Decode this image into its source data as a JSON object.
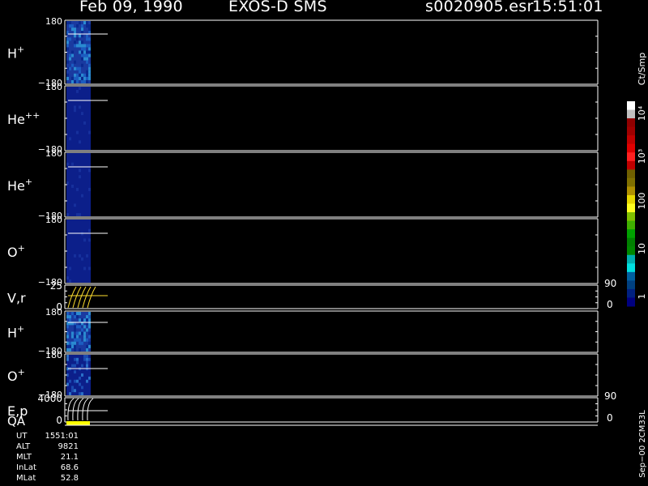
{
  "header": {
    "date": "Feb 09, 1990",
    "instrument": "EXOS-D SMS",
    "file": "s0020905.esr",
    "time": "15:51:01"
  },
  "colorbar": {
    "unit_label": "Ct/Smp",
    "tick_labels": [
      "10⁴",
      "10³",
      "100",
      "10",
      "1"
    ],
    "colors": [
      "#ffffff",
      "#c0c0c0",
      "#900000",
      "#a00000",
      "#c00000",
      "#e00000",
      "#ff2020",
      "#c00000",
      "#706000",
      "#807000",
      "#b09000",
      "#e8d800",
      "#ffff20",
      "#80c000",
      "#40b000",
      "#00a000",
      "#008000",
      "#008800",
      "#00b0b0",
      "#00e0e0",
      "#0060a0",
      "#004080",
      "#002080",
      "#000080"
    ]
  },
  "panels": [
    {
      "label": "H",
      "sup": "+",
      "ymax": "180",
      "ymin": "−180"
    },
    {
      "label": "He",
      "sup": "++",
      "ymax": "180",
      "ymin": "−180"
    },
    {
      "label": "He",
      "sup": "+",
      "ymax": "180",
      "ymin": "−180"
    },
    {
      "label": "O",
      "sup": "+",
      "ymax": "180",
      "ymin": "−180"
    },
    {
      "label": "V,r",
      "sup": "",
      "ymax": "25",
      "ymin": "0",
      "right_top": "90",
      "right_bottom": "0"
    },
    {
      "label": "H",
      "sup": "+",
      "ymax": "180",
      "ymin": "−180"
    },
    {
      "label": "O",
      "sup": "+",
      "ymax": "180",
      "ymin": "−180"
    },
    {
      "label": "E,p",
      "sup": "",
      "ymax": "4000",
      "ymin": "0",
      "right_top": "90",
      "right_bottom": "0"
    }
  ],
  "qa_label": "QA",
  "footer": {
    "rows": [
      {
        "label": "UT",
        "value": "1551:01"
      },
      {
        "label": "ALT",
        "value": "9821"
      },
      {
        "label": "MLT",
        "value": "21.1"
      },
      {
        "label": "InLat",
        "value": "68.6"
      },
      {
        "label": "MLat",
        "value": "52.8"
      }
    ],
    "side_note": "Sep−00 2CM33L"
  },
  "chart_data": {
    "type": "heatmap",
    "title": "Feb 09, 1990   EXOS-D SMS",
    "panels": [
      "H+",
      "He++",
      "He+",
      "O+",
      "V,r",
      "H+",
      "O+",
      "E,p"
    ],
    "colorscale_unit": "Ct/Smp",
    "colorscale_range": [
      1,
      10000
    ],
    "colorscale_log": true
  }
}
